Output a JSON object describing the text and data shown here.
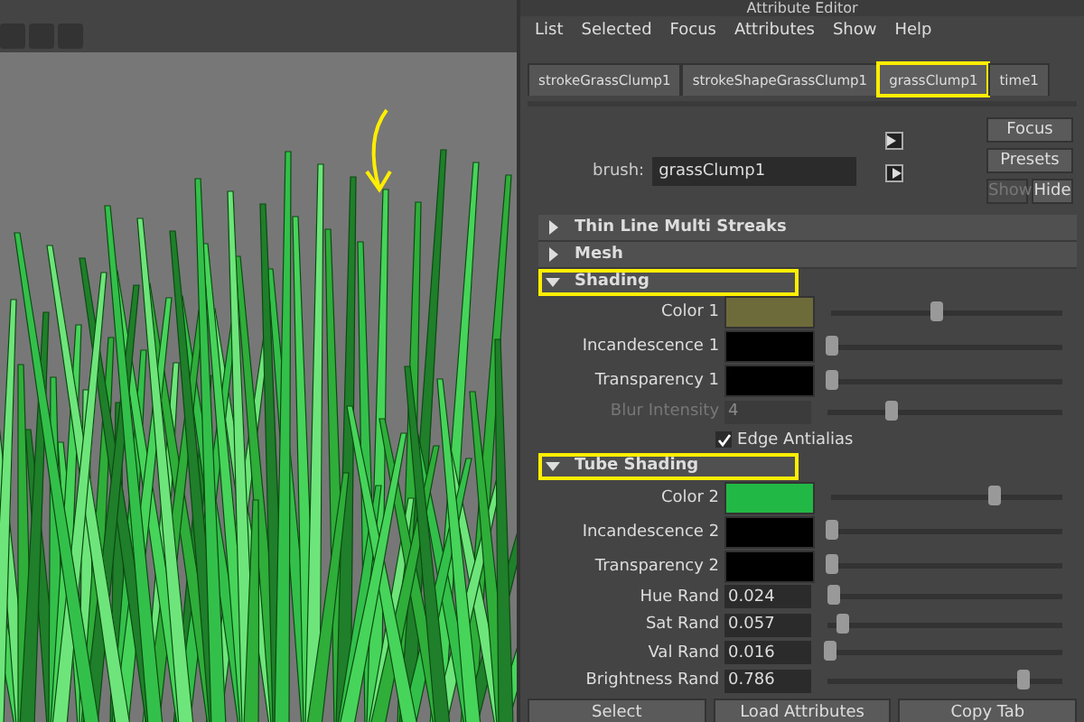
{
  "window": {
    "title": "Attribute Editor"
  },
  "menu": [
    "List",
    "Selected",
    "Focus",
    "Attributes",
    "Show",
    "Help"
  ],
  "tabs": [
    {
      "label": "strokeGrassClump1",
      "selected": false,
      "highlighted": false
    },
    {
      "label": "strokeShapeGrassClump1",
      "selected": false,
      "highlighted": false
    },
    {
      "label": "grassClump1",
      "selected": true,
      "highlighted": true
    },
    {
      "label": "time1",
      "selected": false,
      "highlighted": false
    }
  ],
  "brush": {
    "label": "brush:",
    "value": "grassClump1"
  },
  "side_buttons": [
    {
      "label": "Focus",
      "disabled": false
    },
    {
      "label": "Presets",
      "disabled": false
    }
  ],
  "small_buttons": [
    {
      "label": "Show",
      "disabled": true
    },
    {
      "label": "Hide",
      "disabled": false
    }
  ],
  "sections": [
    {
      "title": "Thin Line Multi Streaks",
      "expanded": false,
      "highlighted": false
    },
    {
      "title": "Mesh",
      "expanded": false,
      "highlighted": false
    },
    {
      "title": "Shading",
      "expanded": true,
      "highlighted": true,
      "rows": [
        {
          "kind": "color",
          "label": "Color 1",
          "color": "#6e6b3a",
          "level": 0.45,
          "disabled": false
        },
        {
          "kind": "color",
          "label": "Incandescence 1",
          "color": "#000000",
          "level": 0,
          "disabled": false
        },
        {
          "kind": "color",
          "label": "Transparency 1",
          "color": "#000000",
          "level": 0,
          "disabled": false
        },
        {
          "kind": "number",
          "label": "Blur Intensity",
          "value": "4",
          "level": 0.27,
          "disabled": true
        },
        {
          "kind": "checkbox",
          "label": "Edge Antialias",
          "checked": true
        }
      ]
    },
    {
      "title": "Tube Shading",
      "expanded": true,
      "highlighted": true,
      "rows": [
        {
          "kind": "color",
          "label": "Color 2",
          "color": "#22b845",
          "level": 0.7,
          "disabled": false
        },
        {
          "kind": "color",
          "label": "Incandescence 2",
          "color": "#000000",
          "level": 0,
          "disabled": false
        },
        {
          "kind": "color",
          "label": "Transparency 2",
          "color": "#000000",
          "level": 0,
          "disabled": false
        },
        {
          "kind": "number",
          "label": "Hue Rand",
          "value": "0.024",
          "level": 0.02,
          "disabled": false
        },
        {
          "kind": "number",
          "label": "Sat Rand",
          "value": "0.057",
          "level": 0.06,
          "disabled": false
        },
        {
          "kind": "number",
          "label": "Val Rand",
          "value": "0.016",
          "level": 0.01,
          "disabled": false
        },
        {
          "kind": "number",
          "label": "Brightness Rand",
          "value": "0.786",
          "level": 0.83,
          "disabled": false
        }
      ]
    }
  ],
  "bottom_buttons": [
    "Select",
    "Load Attributes",
    "Copy Tab"
  ]
}
